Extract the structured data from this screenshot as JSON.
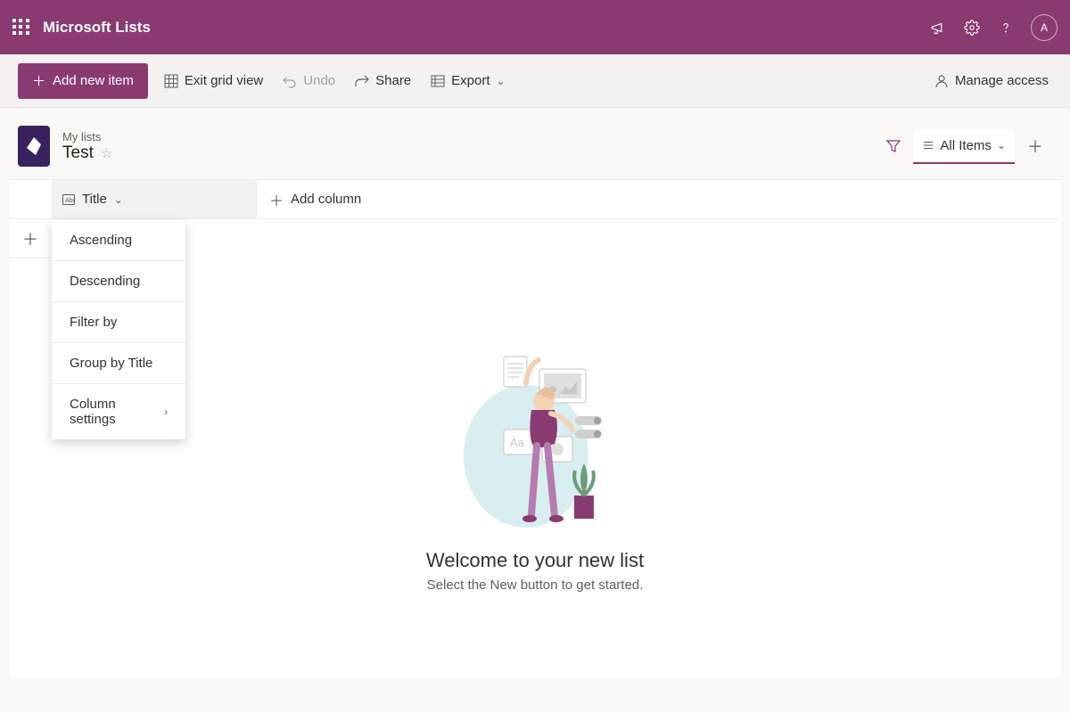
{
  "header": {
    "app_title": "Microsoft Lists",
    "avatar_initial": "A"
  },
  "toolbar": {
    "add_item": "Add new item",
    "exit_grid": "Exit grid view",
    "undo": "Undo",
    "share": "Share",
    "export": "Export",
    "manage_access": "Manage access"
  },
  "list": {
    "breadcrumb": "My lists",
    "name": "Test",
    "view_label": "All Items"
  },
  "columns": {
    "title_col": "Title",
    "add_column": "Add column"
  },
  "column_menu": {
    "ascending": "Ascending",
    "descending": "Descending",
    "filter_by": "Filter by",
    "group_by": "Group by Title",
    "column_settings": "Column settings"
  },
  "empty": {
    "title": "Welcome to your new list",
    "subtitle": "Select the New button to get started."
  }
}
